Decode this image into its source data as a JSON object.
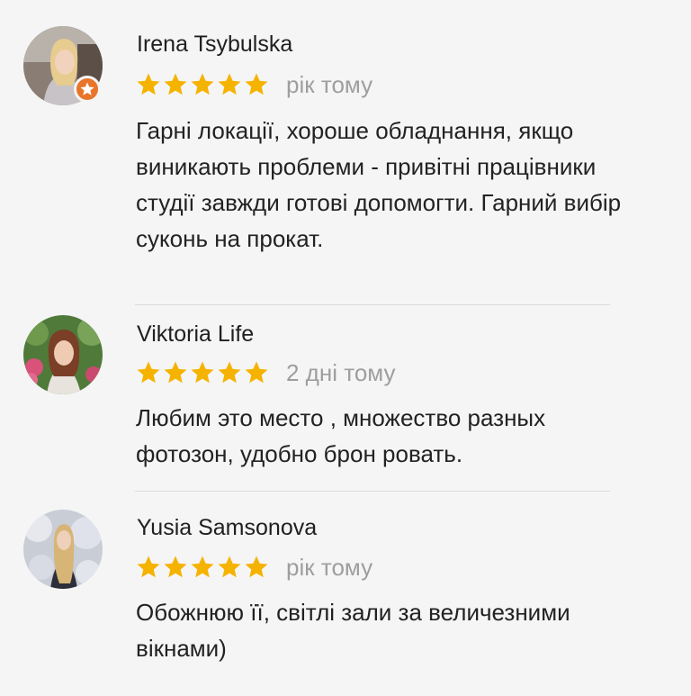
{
  "colors": {
    "background": "#f5f5f5",
    "star": "#f5b300",
    "date_text": "#9e9e9e",
    "badge": "#e8752a",
    "divider": "#dcdcdc"
  },
  "reviews": [
    {
      "author": "Irena Tsybulska",
      "rating": 5,
      "date": "рік тому",
      "text": "Гарні локації, хороше обладнання, якщо виникають проблеми - привітні працівники студії завжди готові допомогти. Гарний вибір суконь на прокат.",
      "local_guide_badge": "star-badge-icon"
    },
    {
      "author": "Viktoria Life",
      "rating": 5,
      "date": "2 дні тому",
      "text": "Любим это место , множество разных фотозон, удобно брон ровать."
    },
    {
      "author": "Yusia Samsonova",
      "rating": 5,
      "date": "рік тому",
      "text": "Обожнюю її, світлі зали за величезними вікнами)"
    }
  ]
}
